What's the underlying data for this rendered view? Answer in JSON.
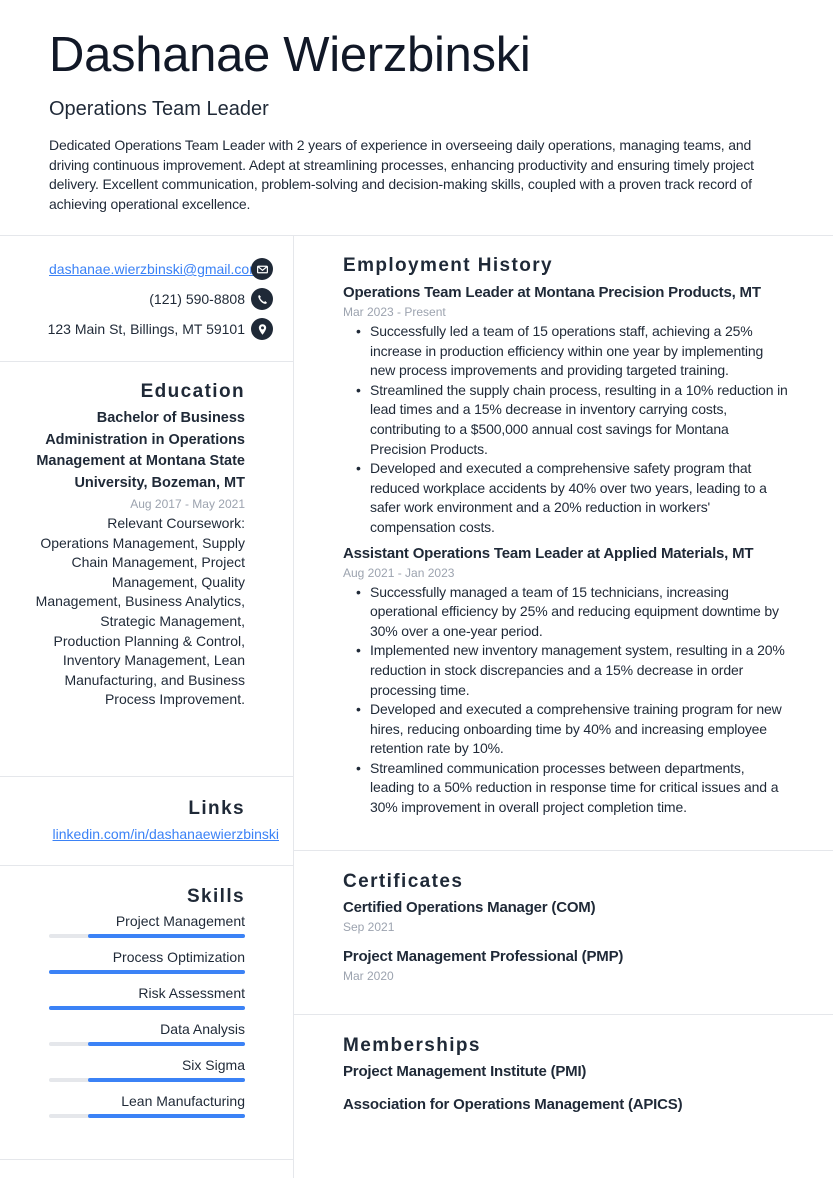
{
  "header": {
    "name": "Dashanae Wierzbinski",
    "title": "Operations Team Leader",
    "summary": "Dedicated Operations Team Leader with 2 years of experience in overseeing daily operations, managing teams, and driving continuous improvement. Adept at streamlining processes, enhancing productivity and ensuring timely project delivery. Excellent communication, problem-solving and decision-making skills, coupled with a proven track record of achieving operational excellence."
  },
  "contact": {
    "email": "dashanae.wierzbinski@gmail.com",
    "email_icon": "envelope-icon",
    "phone": "(121) 590-8808",
    "phone_icon": "phone-icon",
    "address": "123 Main St, Billings, MT 59101",
    "address_icon": "map-pin-icon"
  },
  "education": {
    "heading": "Education",
    "degree": "Bachelor of Business Administration in Operations Management at Montana State University, Bozeman, MT",
    "dates": "Aug 2017 - May 2021",
    "description": "Relevant Coursework: Operations Management, Supply Chain Management, Project Management, Quality Management, Business Analytics, Strategic Management, Production Planning & Control, Inventory Management, Lean Manufacturing, and Business Process Improvement."
  },
  "links": {
    "heading": "Links",
    "items": [
      {
        "label": "linkedin.com/in/dashanaewierzbinski"
      }
    ]
  },
  "skills": {
    "heading": "Skills",
    "accent_color": "#3b82f6",
    "items": [
      {
        "name": "Project Management",
        "level_pct": 80
      },
      {
        "name": "Process Optimization",
        "level_pct": 100
      },
      {
        "name": "Risk Assessment",
        "level_pct": 100
      },
      {
        "name": "Data Analysis",
        "level_pct": 80
      },
      {
        "name": "Six Sigma",
        "level_pct": 80
      },
      {
        "name": "Lean Manufacturing",
        "level_pct": 80
      }
    ]
  },
  "employment": {
    "heading": "Employment History",
    "jobs": [
      {
        "title": "Operations Team Leader at Montana Precision Products, MT",
        "dates": "Mar 2023 - Present",
        "bullets": [
          "Successfully led a team of 15 operations staff, achieving a 25% increase in production efficiency within one year by implementing new process improvements and providing targeted training.",
          "Streamlined the supply chain process, resulting in a 10% reduction in lead times and a 15% decrease in inventory carrying costs, contributing to a $500,000 annual cost savings for Montana Precision Products.",
          "Developed and executed a comprehensive safety program that reduced workplace accidents by 40% over two years, leading to a safer work environment and a 20% reduction in workers' compensation costs."
        ]
      },
      {
        "title": "Assistant Operations Team Leader at Applied Materials, MT",
        "dates": "Aug 2021 - Jan 2023",
        "bullets": [
          "Successfully managed a team of 15 technicians, increasing operational efficiency by 25% and reducing equipment downtime by 30% over a one-year period.",
          "Implemented new inventory management system, resulting in a 20% reduction in stock discrepancies and a 15% decrease in order processing time.",
          "Developed and executed a comprehensive training program for new hires, reducing onboarding time by 40% and increasing employee retention rate by 10%.",
          "Streamlined communication processes between departments, leading to a 50% reduction in response time for critical issues and a 30% improvement in overall project completion time."
        ]
      }
    ]
  },
  "certificates": {
    "heading": "Certificates",
    "items": [
      {
        "name": "Certified Operations Manager (COM)",
        "date": "Sep 2021"
      },
      {
        "name": "Project Management Professional (PMP)",
        "date": "Mar 2020"
      }
    ]
  },
  "memberships": {
    "heading": "Memberships",
    "items": [
      {
        "name": "Project Management Institute (PMI)"
      },
      {
        "name": "Association for Operations Management (APICS)"
      }
    ]
  }
}
